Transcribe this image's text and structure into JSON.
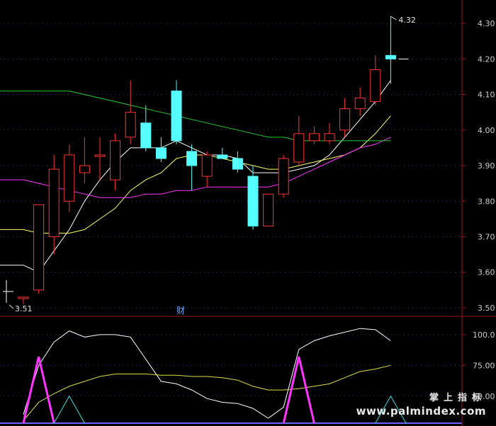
{
  "chart_data": {
    "type": "candlestick",
    "price_panel": {
      "ylim": [
        3.48,
        4.35
      ],
      "y_ticks": [
        "4.30",
        "4.20",
        "4.10",
        "4.00",
        "3.90",
        "3.80",
        "3.70",
        "3.60",
        "3.50"
      ],
      "candles": [
        {
          "o": 3.53,
          "h": 3.53,
          "l": 3.51,
          "c": 3.53
        },
        {
          "o": 3.55,
          "h": 3.79,
          "l": 3.54,
          "c": 3.79
        },
        {
          "o": 3.7,
          "h": 3.93,
          "l": 3.65,
          "c": 3.89
        },
        {
          "o": 3.8,
          "h": 3.96,
          "l": 3.77,
          "c": 3.93
        },
        {
          "o": 3.88,
          "h": 3.98,
          "l": 3.85,
          "c": 3.9
        },
        {
          "o": 3.93,
          "h": 3.98,
          "l": 3.86,
          "c": 3.93
        },
        {
          "o": 3.86,
          "h": 3.99,
          "l": 3.83,
          "c": 3.97
        },
        {
          "o": 3.98,
          "h": 4.14,
          "l": 3.96,
          "c": 4.05
        },
        {
          "o": 4.02,
          "h": 4.07,
          "l": 3.94,
          "c": 3.95
        },
        {
          "o": 3.95,
          "h": 3.98,
          "l": 3.91,
          "c": 3.92
        },
        {
          "o": 4.11,
          "h": 4.14,
          "l": 3.96,
          "c": 3.97
        },
        {
          "o": 3.94,
          "h": 3.96,
          "l": 3.83,
          "c": 3.9
        },
        {
          "o": 3.87,
          "h": 3.94,
          "l": 3.84,
          "c": 3.93
        },
        {
          "o": 3.93,
          "h": 3.95,
          "l": 3.92,
          "c": 3.92
        },
        {
          "o": 3.92,
          "h": 3.94,
          "l": 3.88,
          "c": 3.89
        },
        {
          "o": 3.87,
          "h": 3.9,
          "l": 3.72,
          "c": 3.73
        },
        {
          "o": 3.73,
          "h": 3.82,
          "l": 3.73,
          "c": 3.82
        },
        {
          "o": 3.82,
          "h": 3.93,
          "l": 3.81,
          "c": 3.92
        },
        {
          "o": 3.91,
          "h": 4.04,
          "l": 3.9,
          "c": 3.99
        },
        {
          "o": 3.97,
          "h": 4.01,
          "l": 3.96,
          "c": 3.99
        },
        {
          "o": 3.97,
          "h": 4.02,
          "l": 3.96,
          "c": 3.99
        },
        {
          "o": 4.0,
          "h": 4.09,
          "l": 3.98,
          "c": 4.06
        },
        {
          "o": 4.06,
          "h": 4.12,
          "l": 4.04,
          "c": 4.09
        },
        {
          "o": 4.08,
          "h": 4.21,
          "l": 4.07,
          "c": 4.17
        },
        {
          "o": 4.21,
          "h": 4.32,
          "l": 4.13,
          "c": 4.2
        }
      ],
      "ma_lines": [
        {
          "color": "#ffffff",
          "values": [
            3.62,
            3.6,
            3.66,
            3.72,
            3.8,
            3.86,
            3.91,
            3.95,
            3.95,
            3.95,
            3.97,
            3.95,
            3.93,
            3.93,
            3.92,
            3.88,
            3.88,
            3.88,
            3.89,
            3.9,
            3.93,
            3.98,
            4.03,
            4.08,
            4.14
          ]
        },
        {
          "color": "#ffff66",
          "values": [
            3.72,
            3.71,
            3.71,
            3.71,
            3.72,
            3.75,
            3.78,
            3.83,
            3.86,
            3.88,
            3.92,
            3.93,
            3.93,
            3.92,
            3.91,
            3.9,
            3.89,
            3.89,
            3.9,
            3.91,
            3.92,
            3.93,
            3.95,
            3.99,
            4.04
          ]
        },
        {
          "color": "#ff33ff",
          "values": [
            3.86,
            3.85,
            3.84,
            3.83,
            3.82,
            3.81,
            3.81,
            3.81,
            3.82,
            3.82,
            3.83,
            3.83,
            3.84,
            3.84,
            3.84,
            3.84,
            3.84,
            3.85,
            3.87,
            3.89,
            3.91,
            3.93,
            3.95,
            3.96,
            3.98
          ]
        },
        {
          "color": "#22cc33",
          "values": [
            4.11,
            4.11,
            4.11,
            4.11,
            4.1,
            4.09,
            4.08,
            4.07,
            4.06,
            4.05,
            4.04,
            4.03,
            4.02,
            4.01,
            4.0,
            3.99,
            3.98,
            3.98,
            3.97,
            3.97,
            3.97,
            3.97,
            3.97,
            3.97,
            3.97
          ]
        }
      ],
      "max_marker": "4.32",
      "min_marker": "3.51",
      "caption": "财"
    },
    "indicator_panel": {
      "ylim": [
        28,
        112
      ],
      "y_ticks": [
        "100.0",
        "75.00",
        "50.00"
      ],
      "lines": [
        {
          "color": "#ffffff",
          "values": [
            35,
            75,
            94,
            103,
            98,
            100,
            100,
            98,
            80,
            62,
            60,
            55,
            48,
            45,
            44,
            40,
            32,
            41,
            88,
            95,
            99,
            102,
            105,
            104,
            95
          ]
        },
        {
          "color": "#dddd44",
          "values": [
            30,
            45,
            52,
            58,
            62,
            66,
            68,
            68,
            68,
            67,
            67,
            66,
            66,
            65,
            63,
            58,
            55,
            55,
            56,
            58,
            60,
            65,
            70,
            72,
            75
          ]
        },
        {
          "color": "#ff33ff",
          "values": [
            null,
            82,
            null,
            null,
            null,
            null,
            null,
            null,
            null,
            null,
            null,
            null,
            null,
            null,
            null,
            null,
            null,
            null,
            82,
            null,
            null,
            null,
            null,
            null,
            null
          ]
        },
        {
          "color": "#33dddd",
          "values": [
            null,
            null,
            null,
            50,
            null,
            null,
            null,
            null,
            null,
            null,
            null,
            null,
            null,
            null,
            null,
            null,
            null,
            null,
            null,
            null,
            null,
            null,
            null,
            null,
            50
          ]
        }
      ]
    },
    "colors": {
      "up": "#ff3333",
      "down": "#55ffff",
      "axis": "#a01818",
      "tick": "#cccccc",
      "baseline": "#6666ff"
    }
  },
  "watermark": {
    "cn": "掌上指标",
    "url": "www.palmindex.com"
  }
}
